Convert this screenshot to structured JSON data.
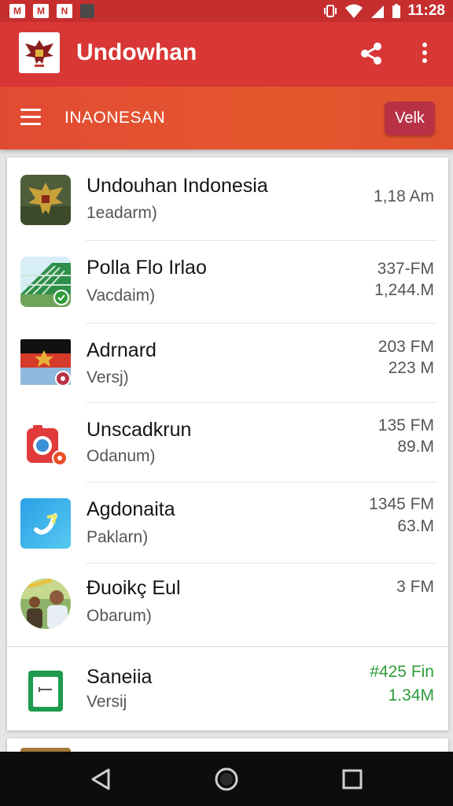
{
  "status_bar": {
    "time": "11:28",
    "left_icons": [
      "gmail-icon",
      "gmail-icon",
      "notification-icon",
      "notification-icon"
    ],
    "left_glyphs": [
      "M",
      "M",
      "N",
      ""
    ],
    "right_icons": [
      "vibrate-icon",
      "wifi-icon",
      "signal-icon",
      "battery-icon"
    ]
  },
  "app_bar": {
    "title": "Undowhan",
    "logo_icon": "garuda-emblem-icon",
    "share_icon": "share-icon",
    "more_icon": "more-vert-icon"
  },
  "sub_bar": {
    "title": "INAONESAN",
    "button_label": "Velk",
    "menu_icon": "hamburger-menu-icon"
  },
  "list": [
    {
      "title": "Undouhan Indonesia",
      "subtitle": "1eadarm)",
      "date": "1,18 Am",
      "size": "",
      "icon": "garuda-emblem-icon"
    },
    {
      "title": "Polla Flo Irlao",
      "subtitle": "Vacdaim)",
      "date": "337-FM",
      "size": "1,244.M",
      "icon": "solar-panel-icon"
    },
    {
      "title": "Adrnard",
      "subtitle": "Versj)",
      "date": "203 FM",
      "size": "223 M",
      "icon": "flag-icon"
    },
    {
      "title": "Unscadkrun",
      "subtitle": "Odanum)",
      "date": "135 FM",
      "size": "89.M",
      "icon": "camera-app-icon"
    },
    {
      "title": "Agdonaita",
      "subtitle": "Paklarn)",
      "date": "1345 FM",
      "size": "63.M",
      "icon": "gradient-app-icon"
    },
    {
      "title": "Đuoikç Eul",
      "subtitle": "Obarum)",
      "date": "3 FM",
      "size": "",
      "icon": "people-photo-icon"
    },
    {
      "title": "Saneiia",
      "subtitle": "Versij",
      "date": "#425 Fin",
      "size": "1.34M",
      "icon": "sheets-app-icon",
      "accent": "#2e9b39"
    }
  ],
  "nav_bar": {
    "back_icon": "back-triangle-icon",
    "home_icon": "home-circle-icon",
    "recents_icon": "recents-square-icon"
  },
  "colors": {
    "app_bar": "#d93636",
    "sub_bar": "#e4572e",
    "button": "#b83246",
    "highlight_text": "#2e9b39"
  }
}
